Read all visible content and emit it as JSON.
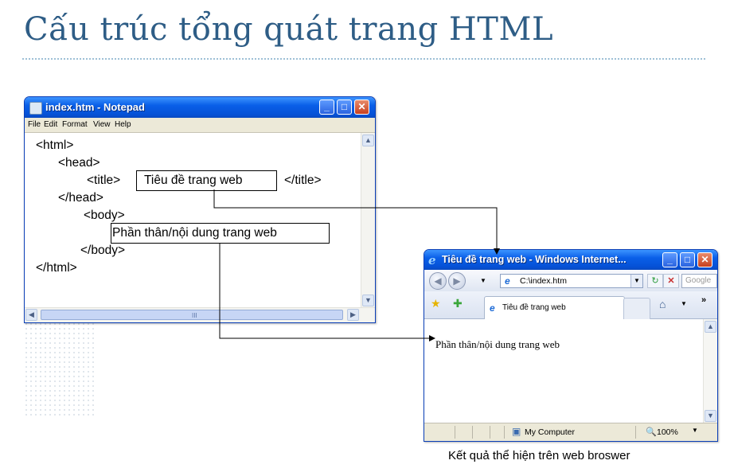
{
  "slide": {
    "title": "Cấu trúc tổng quát trang HTML",
    "caption": "Kết quả thể hiện trên web broswer"
  },
  "notepad": {
    "title": "index.htm - Notepad",
    "menu": [
      "File",
      "Edit",
      "Format",
      "View",
      "Help"
    ],
    "code": {
      "html_open": "<html>",
      "head_open": "<head>",
      "title_open": "<title>",
      "title_text": "Tiêu đề trang web",
      "title_close": "</title>",
      "head_close": "</head>",
      "body_open": "<body>",
      "body_text": "Phần thân/nội dung trang web",
      "body_close": "</body>",
      "html_close": "</html>"
    },
    "hscroll_grip": "III"
  },
  "browser": {
    "title": "Tiêu đề trang web - Windows Internet...",
    "address": "C:\\index.htm",
    "search_placeholder": "Google",
    "tab_label": "Tiêu đề trang web",
    "content_text": "Phần thân/nội dung trang web",
    "status_zone": "My Computer",
    "zoom": "100%"
  },
  "colors": {
    "title_text": "#2e5d86",
    "xp_titlebar": "#0a5fe8",
    "xp_close": "#c8401e",
    "xp_chrome": "#ece9d8"
  }
}
